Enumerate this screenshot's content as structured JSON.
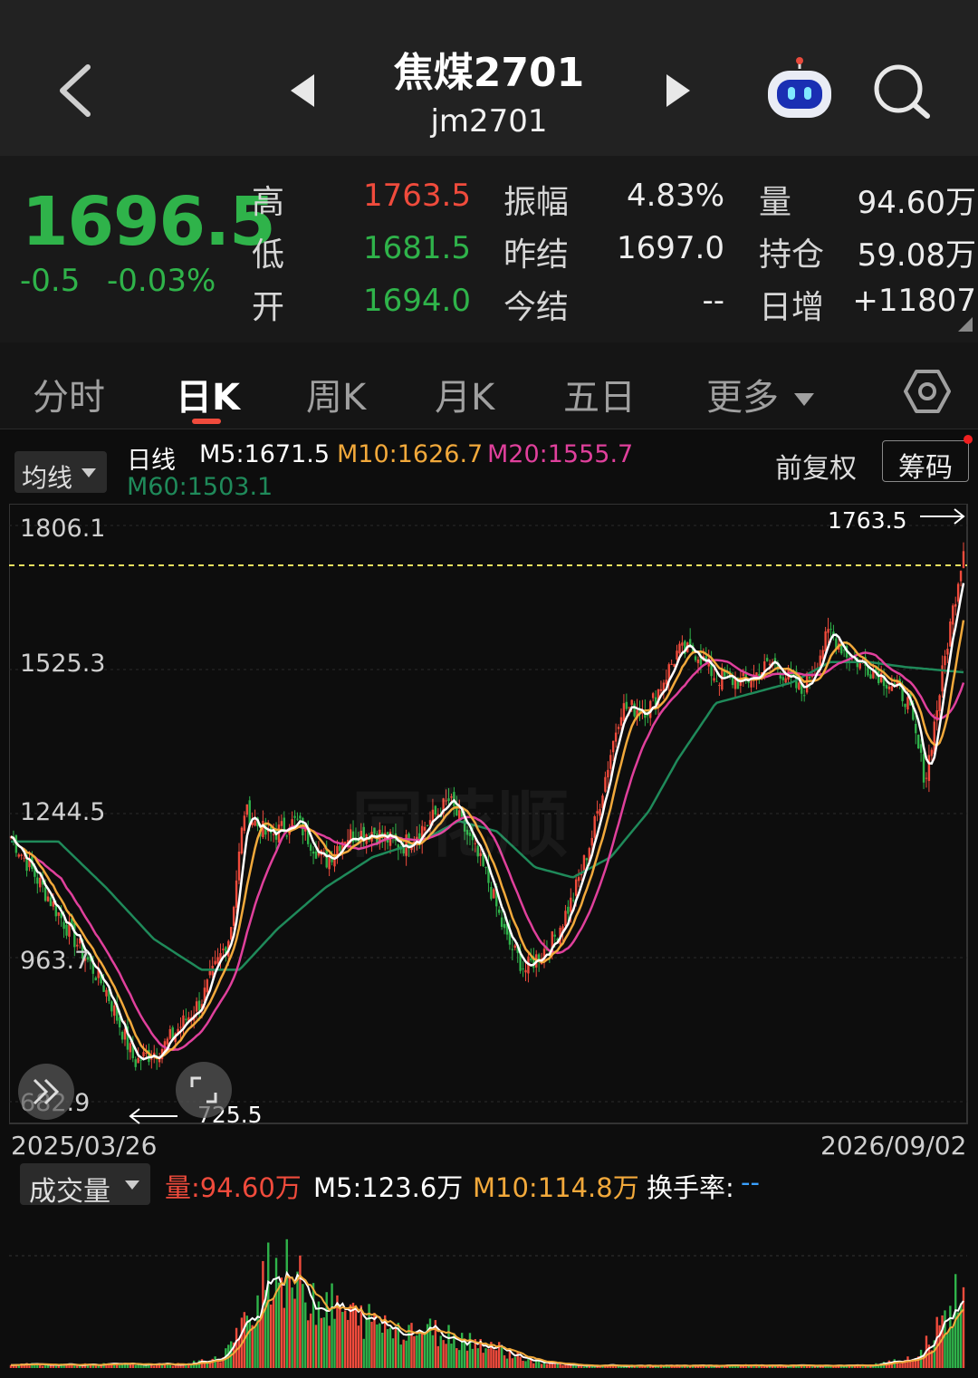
{
  "header": {
    "title": "焦煤2701",
    "code": "jm2701"
  },
  "quote": {
    "price": "1696.5",
    "change": "-0.5",
    "change_pct": "-0.03%",
    "high_label": "高",
    "high": "1763.5",
    "low_label": "低",
    "low": "1681.5",
    "open_label": "开",
    "open": "1694.0",
    "amp_label": "振幅",
    "amp": "4.83%",
    "prev_settle_label": "昨结",
    "prev_settle": "1697.0",
    "settle_label": "今结",
    "settle": "--",
    "vol_label": "量",
    "vol": "94.60万",
    "oi_label": "持仓",
    "oi": "59.08万",
    "oi_chg_label": "日增",
    "oi_chg": "+11807"
  },
  "tabs": [
    "分时",
    "日K",
    "周K",
    "月K",
    "五日",
    "更多"
  ],
  "active_tab": "日K",
  "chart": {
    "ma_dropdown": "均线",
    "line_type": "日线",
    "m5": "M5:1671.5",
    "m10": "M10:1626.7",
    "m20": "M20:1555.7",
    "m60": "M60:1503.1",
    "adjust": "前复权",
    "chip": "筹码",
    "watermark": "同花顺",
    "y_ticks": [
      "1806.1",
      "1525.3",
      "1244.5",
      "963.7",
      "682.9"
    ],
    "high_marker": "1763.5",
    "low_marker": "725.5",
    "date_start": "2025/03/26",
    "date_end": "2026/09/02"
  },
  "volume": {
    "dropdown": "成交量",
    "vol": "量:94.60万",
    "m5": "M5:123.6万",
    "m10": "M10:114.8万",
    "turnover_label": "换手率:",
    "turnover": "--"
  },
  "colors": {
    "up": "#f04b3c",
    "down": "#2fb34a",
    "m5": "#ffffff",
    "m10": "#f2a93b",
    "m20": "#e0409c",
    "m60": "#1f8a5a"
  },
  "chart_data": {
    "type": "candlestick",
    "x_range": [
      "2025/03/26",
      "2026/09/02"
    ],
    "y_range": [
      682.9,
      1806.1
    ],
    "close_path": [
      [
        0,
        1200
      ],
      [
        0.03,
        1110
      ],
      [
        0.07,
        990
      ],
      [
        0.1,
        900
      ],
      [
        0.13,
        760
      ],
      [
        0.16,
        790
      ],
      [
        0.2,
        880
      ],
      [
        0.23,
        1010
      ],
      [
        0.245,
        1250
      ],
      [
        0.27,
        1200
      ],
      [
        0.3,
        1230
      ],
      [
        0.33,
        1150
      ],
      [
        0.35,
        1200
      ],
      [
        0.38,
        1210
      ],
      [
        0.41,
        1180
      ],
      [
        0.44,
        1230
      ],
      [
        0.46,
        1270
      ],
      [
        0.48,
        1200
      ],
      [
        0.5,
        1120
      ],
      [
        0.52,
        1000
      ],
      [
        0.54,
        940
      ],
      [
        0.57,
        1000
      ],
      [
        0.59,
        1080
      ],
      [
        0.61,
        1200
      ],
      [
        0.64,
        1450
      ],
      [
        0.67,
        1450
      ],
      [
        0.7,
        1560
      ],
      [
        0.72,
        1560
      ],
      [
        0.74,
        1510
      ],
      [
        0.77,
        1500
      ],
      [
        0.8,
        1540
      ],
      [
        0.83,
        1480
      ],
      [
        0.86,
        1600
      ],
      [
        0.88,
        1550
      ],
      [
        0.91,
        1520
      ],
      [
        0.94,
        1470
      ],
      [
        0.96,
        1310
      ],
      [
        0.985,
        1600
      ],
      [
        1,
        1763
      ]
    ],
    "m60_path": [
      [
        0,
        1190
      ],
      [
        0.05,
        1190
      ],
      [
        0.1,
        1100
      ],
      [
        0.15,
        1000
      ],
      [
        0.2,
        940
      ],
      [
        0.24,
        940
      ],
      [
        0.28,
        1020
      ],
      [
        0.33,
        1100
      ],
      [
        0.38,
        1160
      ],
      [
        0.43,
        1190
      ],
      [
        0.47,
        1230
      ],
      [
        0.51,
        1210
      ],
      [
        0.55,
        1140
      ],
      [
        0.59,
        1120
      ],
      [
        0.63,
        1160
      ],
      [
        0.67,
        1250
      ],
      [
        0.7,
        1350
      ],
      [
        0.74,
        1460
      ],
      [
        0.78,
        1480
      ],
      [
        0.82,
        1500
      ],
      [
        0.86,
        1540
      ],
      [
        0.9,
        1540
      ],
      [
        0.94,
        1530
      ],
      [
        1,
        1520
      ]
    ],
    "volume_profile": [
      [
        0,
        3
      ],
      [
        0.18,
        3
      ],
      [
        0.22,
        8
      ],
      [
        0.25,
        40
      ],
      [
        0.27,
        90
      ],
      [
        0.3,
        70
      ],
      [
        0.35,
        45
      ],
      [
        0.4,
        35
      ],
      [
        0.45,
        30
      ],
      [
        0.5,
        20
      ],
      [
        0.55,
        5
      ],
      [
        0.6,
        2
      ],
      [
        0.9,
        2
      ],
      [
        0.95,
        8
      ],
      [
        0.98,
        40
      ],
      [
        1,
        70
      ]
    ],
    "y_ticks": [
      1806.1,
      1525.3,
      1244.5,
      963.7,
      682.9
    ]
  }
}
